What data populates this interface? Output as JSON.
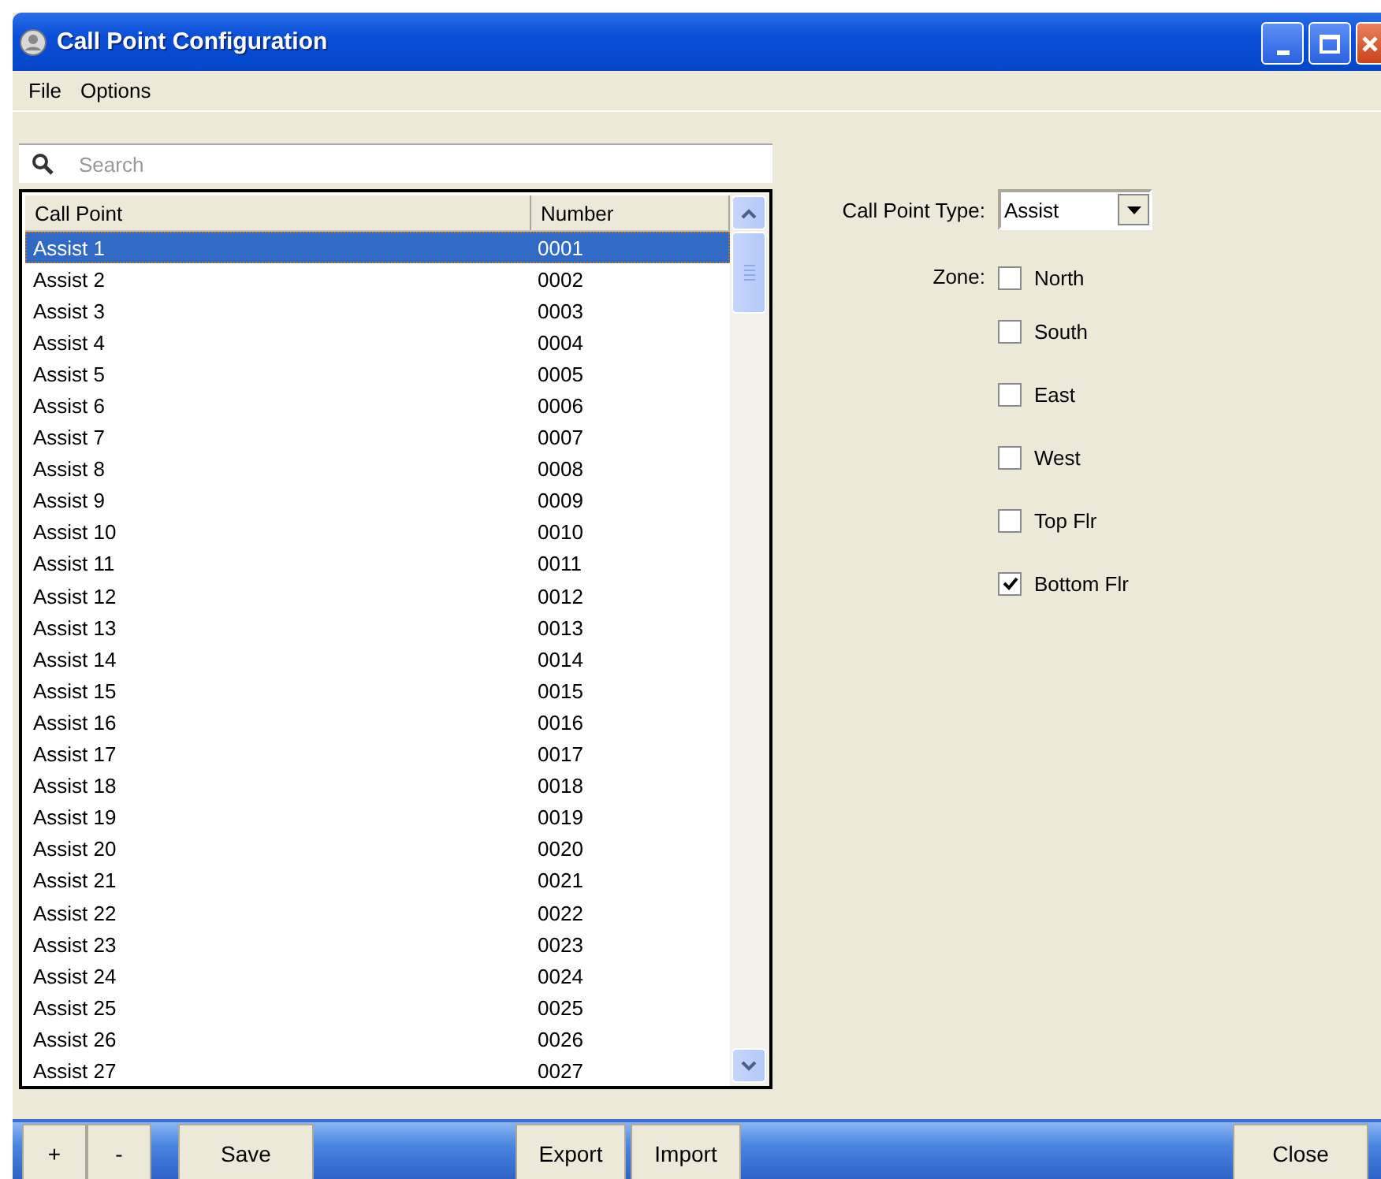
{
  "window": {
    "title": "Call Point Configuration"
  },
  "menu": [
    "File",
    "Options"
  ],
  "search": {
    "placeholder": "Search"
  },
  "table": {
    "columns": [
      "Call Point",
      "Number"
    ],
    "rows": [
      {
        "name": "Assist 1",
        "number": "0001",
        "selected": true
      },
      {
        "name": "Assist 2",
        "number": "0002",
        "selected": false
      },
      {
        "name": "Assist 3",
        "number": "0003",
        "selected": false
      },
      {
        "name": "Assist 4",
        "number": "0004",
        "selected": false
      },
      {
        "name": "Assist 5",
        "number": "0005",
        "selected": false
      },
      {
        "name": "Assist 6",
        "number": "0006",
        "selected": false
      },
      {
        "name": "Assist 7",
        "number": "0007",
        "selected": false
      },
      {
        "name": "Assist 8",
        "number": "0008",
        "selected": false
      },
      {
        "name": "Assist 9",
        "number": "0009",
        "selected": false
      },
      {
        "name": "Assist 10",
        "number": "0010",
        "selected": false
      },
      {
        "name": "Assist 11",
        "number": "0011",
        "selected": false
      },
      {
        "name": "Assist 12",
        "number": "0012",
        "selected": false
      },
      {
        "name": "Assist 13",
        "number": "0013",
        "selected": false
      },
      {
        "name": "Assist 14",
        "number": "0014",
        "selected": false
      },
      {
        "name": "Assist 15",
        "number": "0015",
        "selected": false
      },
      {
        "name": "Assist 16",
        "number": "0016",
        "selected": false
      },
      {
        "name": "Assist 17",
        "number": "0017",
        "selected": false
      },
      {
        "name": "Assist 18",
        "number": "0018",
        "selected": false
      },
      {
        "name": "Assist 19",
        "number": "0019",
        "selected": false
      },
      {
        "name": "Assist 20",
        "number": "0020",
        "selected": false
      },
      {
        "name": "Assist 21",
        "number": "0021",
        "selected": false
      },
      {
        "name": "Assist 22",
        "number": "0022",
        "selected": false
      },
      {
        "name": "Assist 23",
        "number": "0023",
        "selected": false
      },
      {
        "name": "Assist 24",
        "number": "0024",
        "selected": false
      },
      {
        "name": "Assist 25",
        "number": "0025",
        "selected": false
      },
      {
        "name": "Assist 26",
        "number": "0026",
        "selected": false
      },
      {
        "name": "Assist 27",
        "number": "0027",
        "selected": false
      }
    ]
  },
  "type_field": {
    "label": "Call Point Type:",
    "value": "Assist"
  },
  "zone": {
    "label": "Zone:",
    "options": [
      {
        "label": "North",
        "checked": false
      },
      {
        "label": "South",
        "checked": false
      },
      {
        "label": "East",
        "checked": false
      },
      {
        "label": "West",
        "checked": false
      },
      {
        "label": "Top Flr",
        "checked": false
      },
      {
        "label": "Bottom Flr",
        "checked": true
      }
    ]
  },
  "buttons": [
    {
      "label": "+",
      "kind": "narrow"
    },
    {
      "label": "-",
      "kind": "narrow"
    },
    {
      "label": "Save",
      "kind": "wide"
    },
    {
      "label": "Export",
      "kind": "mid"
    },
    {
      "label": "Import",
      "kind": "mid"
    },
    {
      "label": "Close",
      "kind": "wide"
    }
  ]
}
